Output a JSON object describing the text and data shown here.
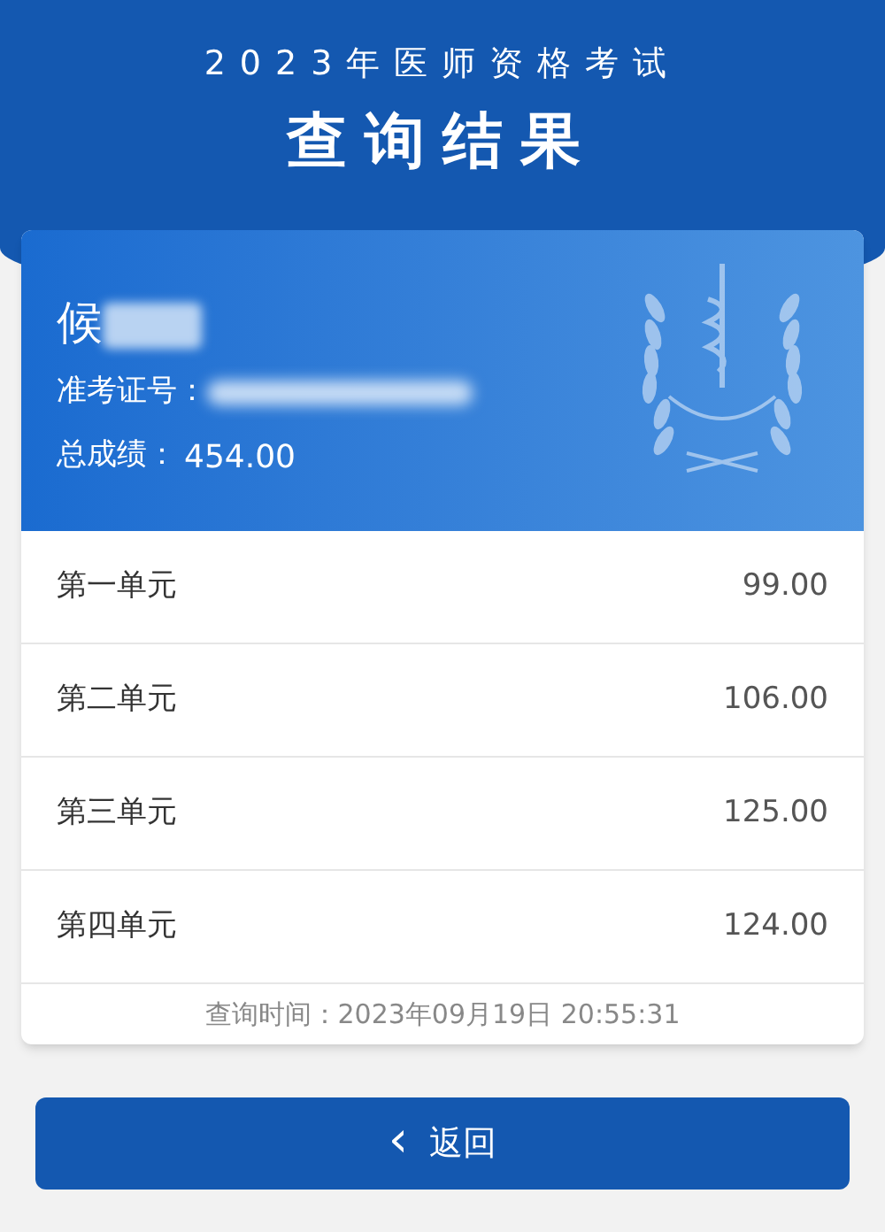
{
  "header": {
    "subtitle": "2023年医师资格考试",
    "title": "查询结果"
  },
  "candidate": {
    "name": "候",
    "id_label": "准考证号：",
    "total_label": "总成绩：",
    "total": "454.00"
  },
  "units": [
    {
      "name": "第一单元",
      "score": "99.00"
    },
    {
      "name": "第二单元",
      "score": "106.00"
    },
    {
      "name": "第三单元",
      "score": "125.00"
    },
    {
      "name": "第四单元",
      "score": "124.00"
    }
  ],
  "query_time": "查询时间：2023年09月19日 20:55:31",
  "back_button": {
    "icon": "‹",
    "label": "返回"
  }
}
